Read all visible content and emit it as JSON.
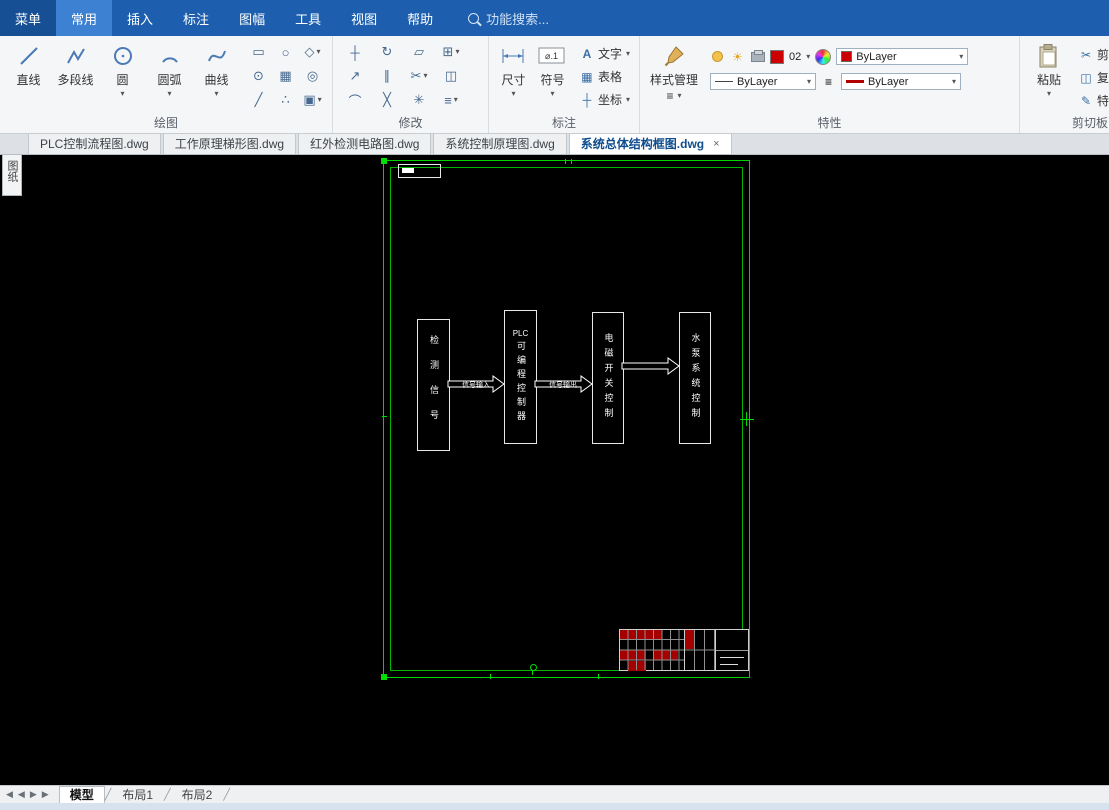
{
  "menu": {
    "items": [
      {
        "label": "菜单"
      },
      {
        "label": "常用",
        "active": true
      },
      {
        "label": "插入"
      },
      {
        "label": "标注"
      },
      {
        "label": "图幅"
      },
      {
        "label": "工具"
      },
      {
        "label": "视图"
      },
      {
        "label": "帮助"
      }
    ],
    "search_placeholder": "功能搜索..."
  },
  "ribbon": {
    "draw": {
      "label": "绘图",
      "line": "直线",
      "polyline": "多段线",
      "circle": "圆",
      "arc": "圆弧",
      "spline": "曲线"
    },
    "modify": {
      "label": "修改"
    },
    "annotate": {
      "label": "标注",
      "dimension": "尺寸",
      "symbol": "符号",
      "symbol_icon": "⌀.1",
      "text": "文字",
      "table": "表格",
      "coordinate": "坐标"
    },
    "properties": {
      "label": "特性",
      "style_manager": "样式管理",
      "color_value": "02",
      "layer_value": "ByLayer",
      "linetype_value": "ByLayer",
      "lineweight_value": "ByLayer"
    },
    "clipboard": {
      "label": "剪切板",
      "paste": "粘贴",
      "cut": "剪切",
      "copy": "复制",
      "match": "特性"
    }
  },
  "doc_tabs": [
    {
      "label": "PLC控制流程图.dwg"
    },
    {
      "label": "工作原理梯形图.dwg"
    },
    {
      "label": "红外检测电路图.dwg"
    },
    {
      "label": "系统控制原理图.dwg"
    },
    {
      "label": "系统总体结构框图.dwg",
      "active": true
    }
  ],
  "side_tab": "图纸",
  "canvas": {
    "diagram": {
      "boxes": [
        {
          "label": "检测信号"
        },
        {
          "top": "PLC",
          "label": "可编程控制器"
        },
        {
          "label": "电磁开关控制"
        },
        {
          "label": "水泵系统控制"
        }
      ],
      "arrow1_label": "信号输入",
      "arrow2_label": "信号输出"
    }
  },
  "statusbar": {
    "model_tab": "模型",
    "layout1_tab": "布局1",
    "layout2_tab": "布局2"
  },
  "colors": {
    "accent": "#1d5fae",
    "sheet_green": "#00d400",
    "red": "#cc0000"
  }
}
